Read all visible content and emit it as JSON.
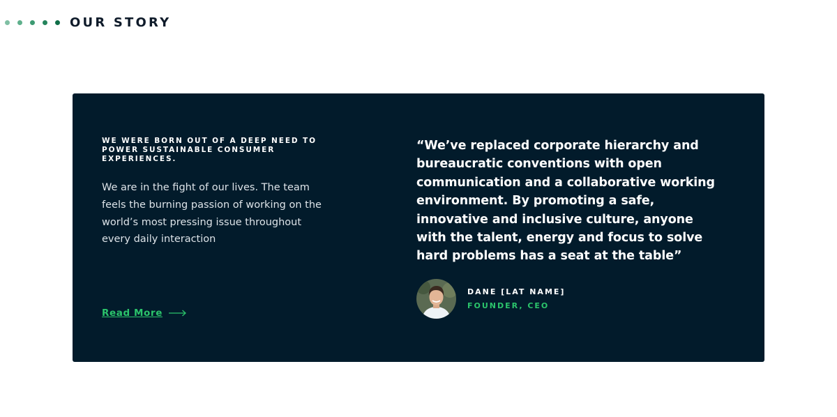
{
  "header": {
    "title": "OUR STORY",
    "dot_colors": [
      "#7fbfa3",
      "#5fb08c",
      "#3d9a72",
      "#24845c",
      "#0f6e48"
    ]
  },
  "card": {
    "background": "#021b2b",
    "eyebrow": "WE WERE BORN OUT OF A DEEP NEED TO POWER SUSTAINABLE CONSUMER EXPERIENCES.",
    "body": "We are in the fight of our lives. The team feels the burning passion of working on the world’s most pressing issue throughout every daily interaction",
    "read_more": {
      "label": "Read More",
      "icon": "arrow-right-icon",
      "color": "#2bc46b"
    },
    "quote": "“We’ve replaced corporate hierarchy and bureaucratic conventions with open communication and a collaborative working environment. By promoting a safe, innovative and inclusive culture, anyone with the talent, energy and focus to solve hard problems has a seat at the table”",
    "author": {
      "avatar_icon": "person-avatar-icon",
      "name": "DANE [LAT NAME]",
      "role": "FOUNDER, CEO"
    }
  }
}
